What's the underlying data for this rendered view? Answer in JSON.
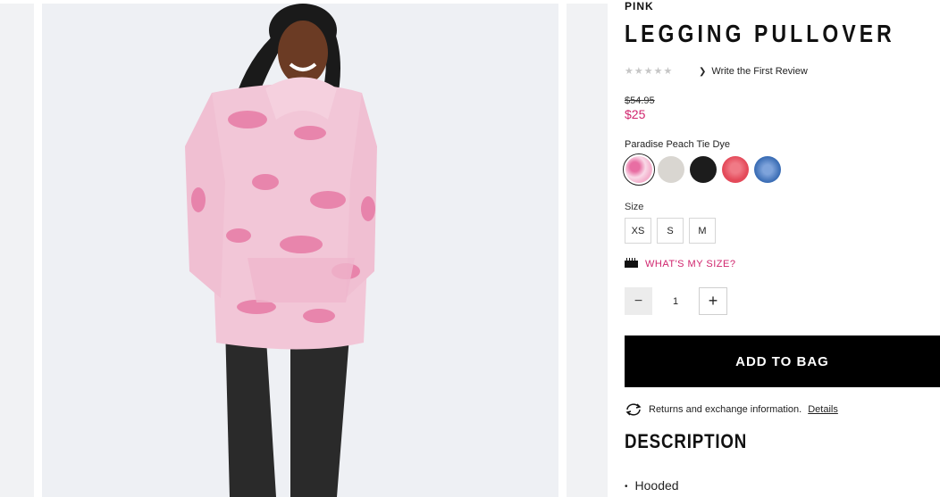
{
  "product": {
    "brand": "PINK",
    "title": "LEGGING PULLOVER",
    "rating_stars": "★★★★★",
    "review_link": "Write the First Review",
    "price_original": "$54.95",
    "price_sale": "$25",
    "color_label": "Paradise Peach Tie Dye",
    "swatches": [
      {
        "name": "Paradise Peach Tie Dye",
        "color": "#f5bcd6",
        "selected": true
      },
      {
        "name": "Oatmeal",
        "color": "#d9d6d1"
      },
      {
        "name": "Black",
        "color": "#1c1c1c"
      },
      {
        "name": "Red Print",
        "color": "#e44a5a"
      },
      {
        "name": "Blue Print",
        "color": "#3d6fb6"
      }
    ],
    "size_label": "Size",
    "sizes": [
      "XS",
      "S",
      "M"
    ],
    "whats_my_size": "WHAT'S MY SIZE?",
    "quantity": "1",
    "quantity_minus": "−",
    "quantity_plus": "+",
    "add_to_bag": "ADD TO BAG",
    "returns_text": "Returns and exchange information.",
    "returns_link": "Details",
    "description_title": "DESCRIPTION",
    "description_bullets": [
      "Hooded"
    ]
  },
  "colors": {
    "accent": "#d0246d",
    "button_bg": "#000000",
    "image_bg": "#eef0f4"
  },
  "icons": {
    "ruler": "ruler-icon",
    "returns": "refresh-icon",
    "chevron": "chevron-right-icon"
  }
}
